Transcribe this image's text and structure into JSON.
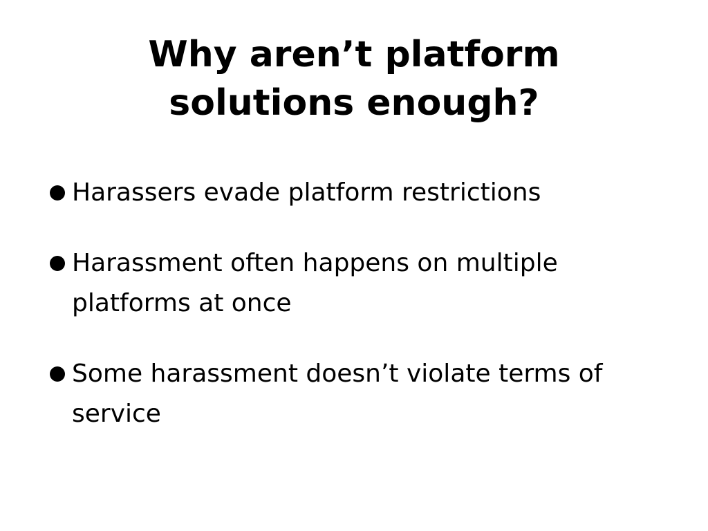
{
  "slide": {
    "title_lines": [
      "Why aren’t platform",
      "solutions enough?"
    ],
    "bullets": [
      "Harassers evade platform restrictions",
      "Harassment often happens on multiple platforms at once",
      "Some harassment doesn’t violate terms of service"
    ]
  }
}
